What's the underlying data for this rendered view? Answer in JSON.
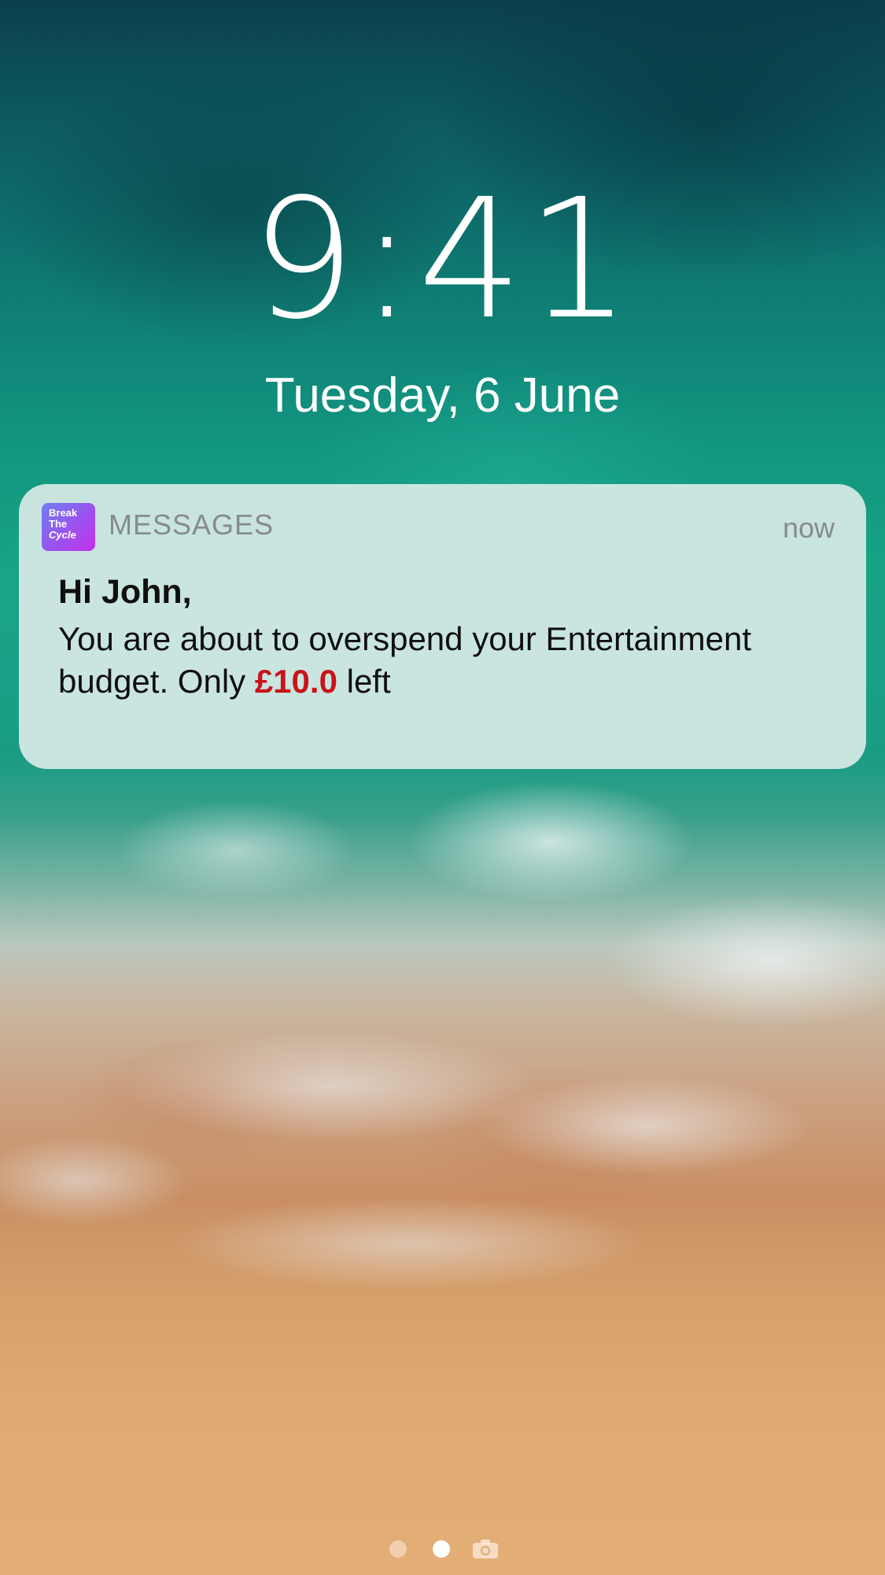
{
  "lockscreen": {
    "time": "9:41",
    "date": "Tuesday, 6 June"
  },
  "notification": {
    "app_icon": {
      "line1": "Break",
      "line2": "The",
      "line3": "Cycle"
    },
    "app_name": "MESSAGES",
    "timestamp": "now",
    "title": "Hi John,",
    "body_line1": "You are about to overspend your Entertainment",
    "body_prefix": "budget. Only ",
    "amount": "£10.0",
    "body_suffix": " left",
    "amount_color": "#c8141a"
  },
  "page_indicator": {
    "pages": 2,
    "current_page": 2,
    "trailing_icon": "camera-icon"
  }
}
